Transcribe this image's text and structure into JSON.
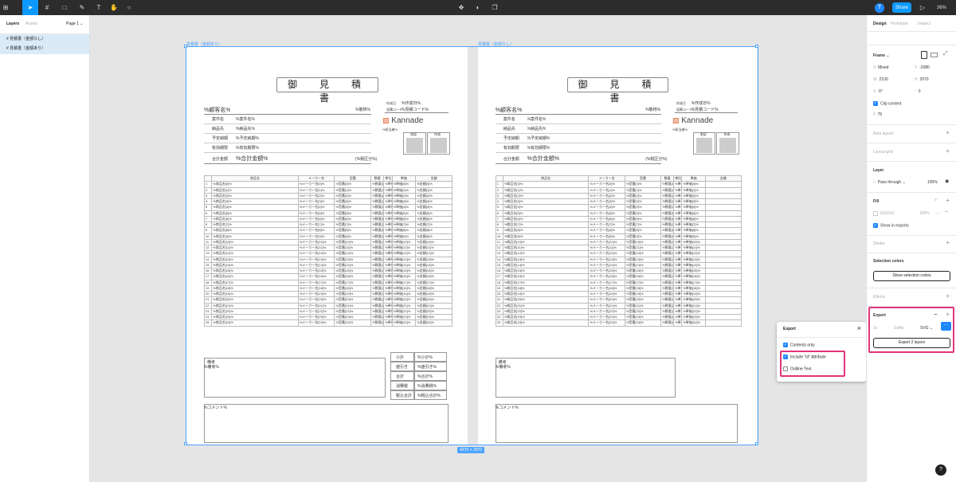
{
  "toolbar": {
    "share": "Share",
    "zoom": "36%",
    "avatar": "T",
    "accent": "#0d99ff"
  },
  "left_panel": {
    "tabs": [
      "Layers",
      "Assets"
    ],
    "page": "Page 1",
    "layers": [
      "見積書（金額なし）",
      "見積書（金額あり）"
    ]
  },
  "right_panel": {
    "tabs": [
      "Design",
      "Prototype",
      "Inspect"
    ],
    "frame_label": "Frame",
    "fields": {
      "x": "Mixed",
      "y": "-2080",
      "w": "2100",
      "h": "2970",
      "rotation": "0°",
      "radius": "0",
      "clip": "Clip content",
      "opacity": "75"
    },
    "sections": {
      "auto_layout": "Auto layout",
      "layout_grid": "Layout grid",
      "layer": "Layer",
      "fill": "Fill",
      "stroke": "Stroke",
      "selection_colors": "Selection colors",
      "effects": "Effects",
      "export": "Export"
    },
    "layer_mode": "Pass through",
    "layer_opacity": "100%",
    "fill_hex": "FFFFFF",
    "fill_opacity": "100%",
    "show_in_exports": "Show in exports",
    "show_selection_colors": "Show selection colors",
    "export_scale": "1x",
    "export_suffix": "Suffix",
    "export_format": "SVG",
    "export_button": "Export 2 layers"
  },
  "popup": {
    "title": "Export",
    "options": [
      {
        "label": "Contents only",
        "checked": true
      },
      {
        "label": "Include \"id\" Attribute",
        "checked": true
      },
      {
        "label": "Outline Text",
        "checked": false
      }
    ]
  },
  "canvas": {
    "frame1_label": "見積書（金額あり）",
    "frame2_label": "見積書（金額なし）",
    "size_badge": "4275 × 2970",
    "badge_color": "#4da3ff",
    "highlight_color": "#e0357a"
  },
  "doc": {
    "title": "御　見　積　書",
    "customer": "%顧客名%",
    "honorific": "%敬称%",
    "date_label": "作成日",
    "date_value": "%作成日%",
    "code_label": "見積コード",
    "code_value": "%見積コード%",
    "company": "Kannade",
    "staff": "%担当者%",
    "info": [
      {
        "label": "案件名",
        "value": "%案件名%"
      },
      {
        "label": "納品先",
        "value": "%納品先%"
      },
      {
        "label": "予定納期",
        "value": "%予定納期%"
      },
      {
        "label": "有効期限",
        "value": "%有効期限%"
      }
    ],
    "total_label": "合計金額",
    "total_value": "%合計金額%",
    "tax_note": "(%税区分%)",
    "stamps": [
      "承認",
      "作成"
    ],
    "headers": [
      "",
      "商品名",
      "メーカー名",
      "型番",
      "数量",
      "単位",
      "単価",
      "金額"
    ],
    "remarks_label": "備考",
    "remarks_value": "%備考%",
    "comment": "%コメント%",
    "summary": [
      {
        "label": "小計",
        "value": "%小計%"
      },
      {
        "label": "値引き",
        "value": "%値引き%"
      },
      {
        "label": "合計",
        "value": "%合計%"
      },
      {
        "label": "消費税",
        "value": "%消費税%"
      },
      {
        "label": "税込合計",
        "value": "%税込合計%"
      }
    ]
  }
}
